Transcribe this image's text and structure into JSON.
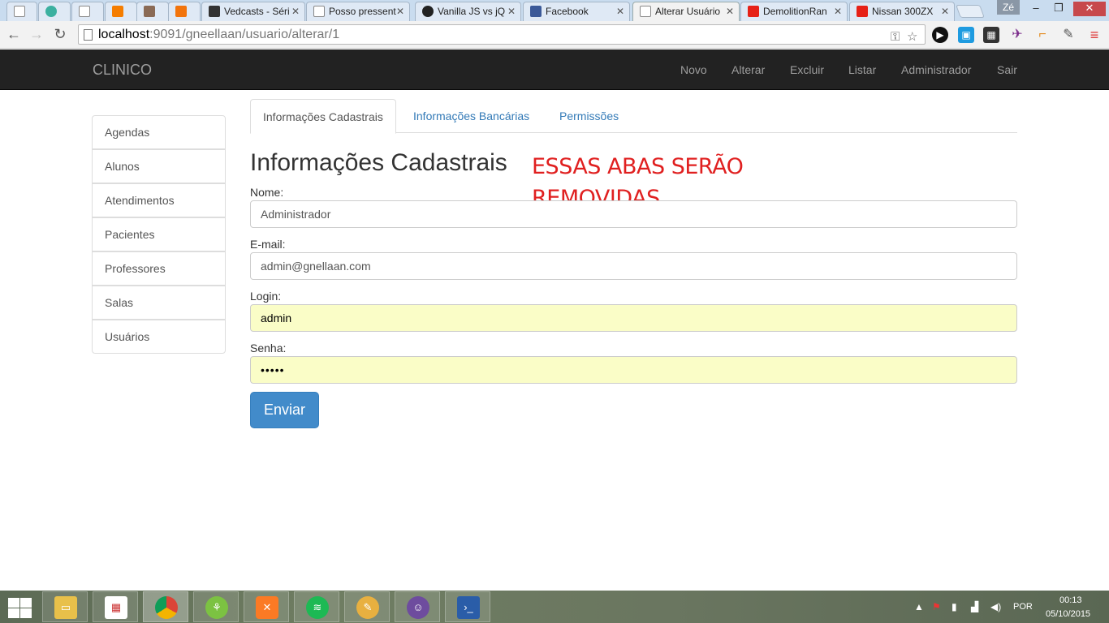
{
  "browser": {
    "tabs": [
      {
        "title": "",
        "icon": "page-icon"
      },
      {
        "title": "",
        "icon": "snowflake-icon"
      },
      {
        "title": "",
        "icon": "page-icon"
      },
      {
        "title": "",
        "icon": "blogger-icon"
      },
      {
        "title": "",
        "icon": "avatar-icon"
      },
      {
        "title": "",
        "icon": "stackoverflow-icon"
      },
      {
        "title": "Vedcasts - Séri",
        "icon": "vedcasts-icon"
      },
      {
        "title": "Posso pressent",
        "icon": "page-icon"
      },
      {
        "title": "Vanilla JS vs jQ",
        "icon": "github-icon"
      },
      {
        "title": "Facebook",
        "icon": "facebook-icon"
      },
      {
        "title": "Alterar Usuário",
        "icon": "page-icon"
      },
      {
        "title": "DemolitionRan",
        "icon": "youtube-icon"
      },
      {
        "title": "Nissan 300ZX",
        "icon": "youtube-icon"
      }
    ],
    "profile_name": "Zé",
    "url_host": "localhost",
    "url_path": ":9091/gneellaan/usuario/alterar/1",
    "colors": {
      "youtube": "#e62117",
      "facebook": "#3b5998",
      "blogger": "#f57d00"
    }
  },
  "navbar": {
    "brand": "CLINICO",
    "links": [
      "Novo",
      "Alterar",
      "Excluir",
      "Listar",
      "Administrador",
      "Sair"
    ]
  },
  "sidebar": {
    "items": [
      "Agendas",
      "Alunos",
      "Atendimentos",
      "Pacientes",
      "Professores",
      "Salas",
      "Usuários"
    ]
  },
  "tabs": {
    "items": [
      "Informações Cadastrais",
      "Informações Bancárias",
      "Permissões"
    ],
    "active": "Informações Cadastrais"
  },
  "form": {
    "title": "Informações Cadastrais",
    "annotation": "ESSAS ABAS SERÃO REMOVIDAS",
    "nome_label": "Nome:",
    "nome_value": "Administrador",
    "email_label": "E-mail:",
    "email_value": "admin@gnellaan.com",
    "login_label": "Login:",
    "login_value": "admin",
    "senha_label": "Senha:",
    "senha_value": "•••••",
    "submit_label": "Enviar"
  },
  "taskbar": {
    "language": "POR",
    "time": "00:13",
    "date": "05/10/2015",
    "apps": [
      "file-explorer-icon",
      "apps-grid-icon",
      "chrome-icon",
      "xampp-icon",
      "xampp-panel-icon",
      "spotify-icon",
      "paint-icon",
      "github-desktop-icon",
      "powershell-icon"
    ]
  }
}
